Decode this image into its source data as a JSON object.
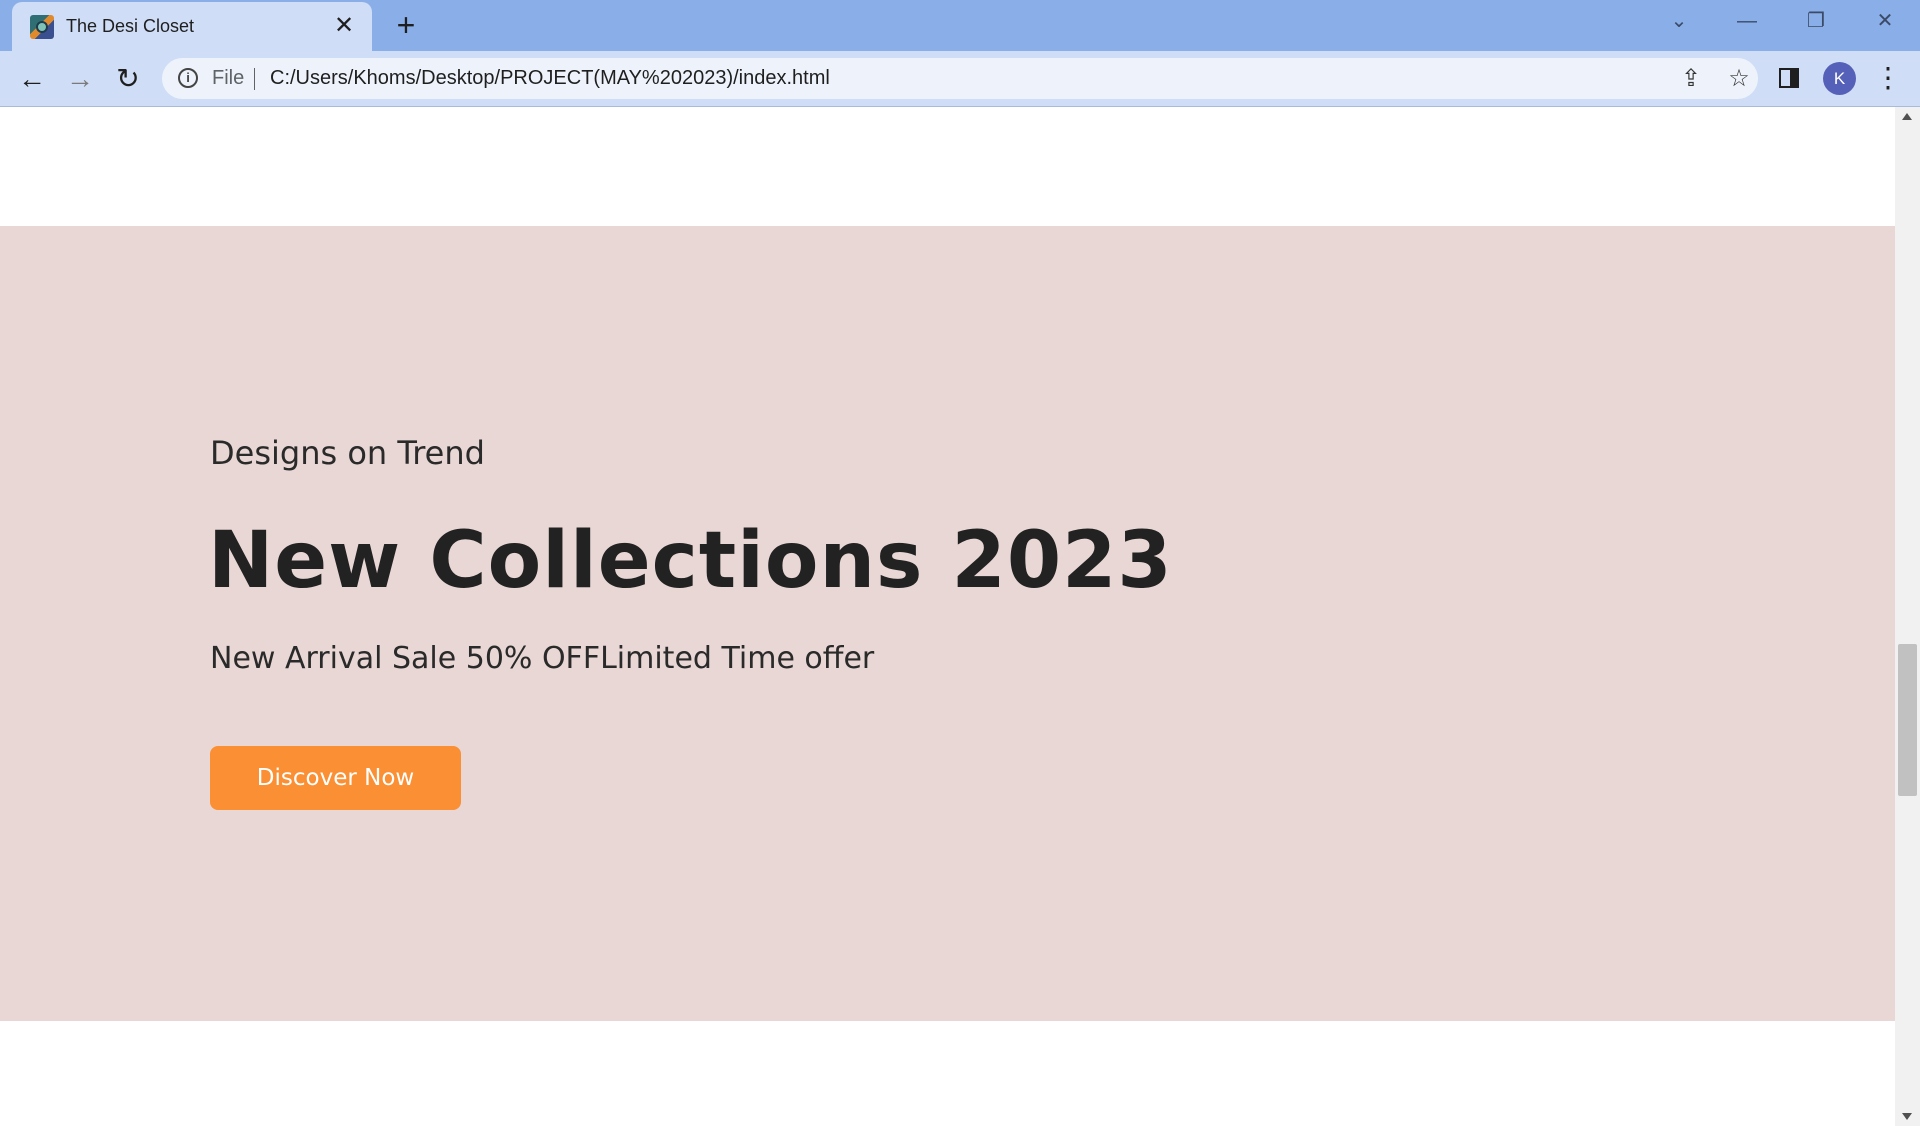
{
  "browser": {
    "tab_title": "The Desi Closet",
    "tab_close": "✕",
    "new_tab": "+",
    "file_label": "File",
    "url": "C:/Users/Khoms/Desktop/PROJECT(MAY%202023)/index.html",
    "profile_initial": "K",
    "icons": {
      "favicon": "site-favicon",
      "back": "back-arrow-icon",
      "forward": "forward-arrow-icon",
      "reload": "reload-icon",
      "info": "info-icon",
      "share": "share-icon",
      "bookmark": "star-icon",
      "side_panel": "side-panel-icon",
      "menu": "kebab-menu-icon"
    }
  },
  "hero": {
    "subtitle": "Designs on Trend",
    "title": "New Collections 2023",
    "description": "New Arrival Sale 50% OFFLimited Time offer",
    "button_label": "Discover Now"
  },
  "colors": {
    "tabstrip": "#8aaee8",
    "toolbar": "#cfddf6",
    "hero_background": "#e8d7d4",
    "button": "#fb8f33",
    "avatar": "#5560b8"
  }
}
